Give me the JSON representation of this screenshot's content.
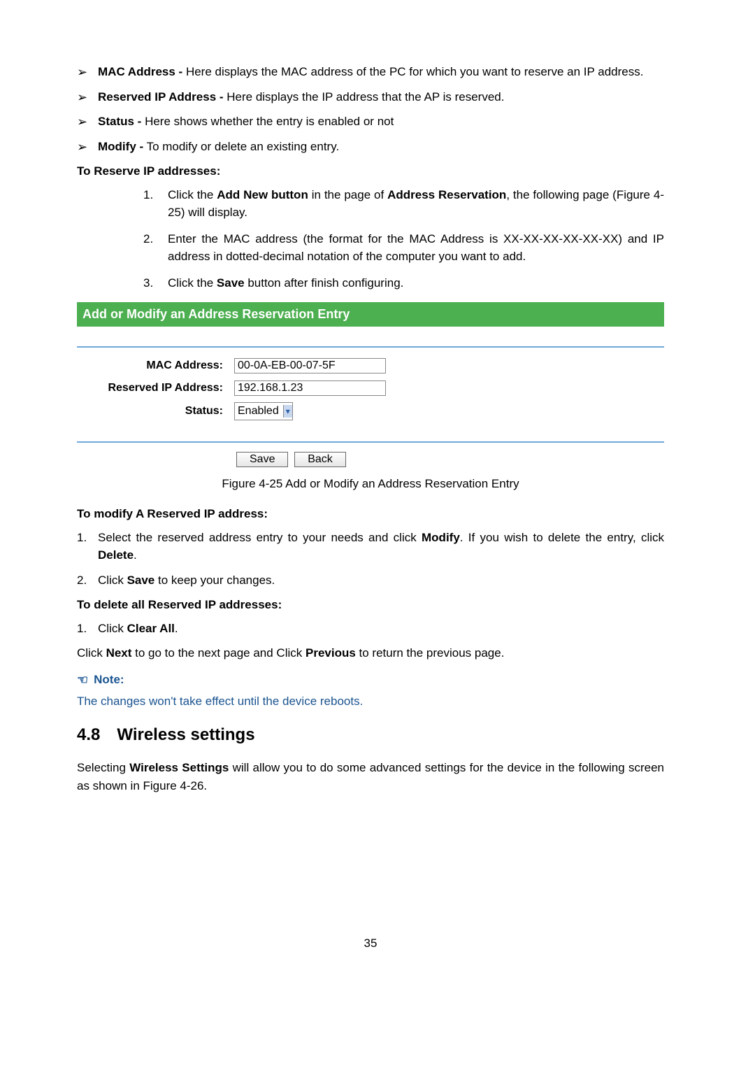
{
  "bullets": {
    "mac_addr_label": "MAC Address -",
    "mac_addr_text": " Here displays the MAC address of the PC for which you want to reserve an IP address.",
    "reserved_ip_label": "Reserved IP Address -",
    "reserved_ip_text": " Here displays the IP address that the AP is reserved.",
    "status_label": "Status -",
    "status_text": " Here shows whether the entry is enabled or not",
    "modify_label": "Modify -",
    "modify_text": " To modify or delete an existing entry."
  },
  "heading_reserve": "To Reserve IP addresses:",
  "reserve_steps": {
    "s1_pre": "Click the ",
    "s1_bold1": "Add New button",
    "s1_mid": " in the page of ",
    "s1_bold2": "Address Reservation",
    "s1_post": ", the following page (Figure 4-25) will display.",
    "s2": "Enter the MAC address (the format for the MAC Address is XX-XX-XX-XX-XX-XX) and IP address in dotted-decimal notation of the computer you want to add.",
    "s3_pre": "Click the ",
    "s3_bold": "Save",
    "s3_post": " button after finish configuring."
  },
  "figure": {
    "title": "Add or Modify an Address Reservation Entry",
    "mac_label": "MAC Address:",
    "mac_value": "00-0A-EB-00-07-5F",
    "ip_label": "Reserved IP Address:",
    "ip_value": "192.168.1.23",
    "status_label": "Status:",
    "status_value": "Enabled",
    "save_btn": "Save",
    "back_btn": "Back",
    "caption": "Figure 4-25 Add or Modify an Address Reservation Entry"
  },
  "heading_modify": "To modify A Reserved IP address:",
  "modify_steps": {
    "s1_pre": "Select the reserved address entry to your needs and click ",
    "s1_bold1": "Modify",
    "s1_mid": ". If you wish to delete the entry, click ",
    "s1_bold2": "Delete",
    "s1_post": ".",
    "s2_pre": "Click ",
    "s2_bold": "Save",
    "s2_post": " to keep your changes."
  },
  "heading_delete": "To delete all Reserved IP addresses:",
  "delete_steps": {
    "s1_pre": "Click ",
    "s1_bold": "Clear All",
    "s1_post": "."
  },
  "next_prev": {
    "pre": "Click ",
    "b1": "Next",
    "mid": " to go to the next page and Click ",
    "b2": "Previous",
    "post": " to return the previous page."
  },
  "note": {
    "label": "Note:",
    "text": "The changes won't take effect until the device reboots."
  },
  "section": {
    "num": "4.8",
    "title": "Wireless settings"
  },
  "wireless_text": {
    "pre": "Selecting ",
    "bold": "Wireless Settings",
    "post": " will allow you to do some advanced settings for the device in the following screen as shown in Figure 4-26."
  },
  "page_number": "35"
}
